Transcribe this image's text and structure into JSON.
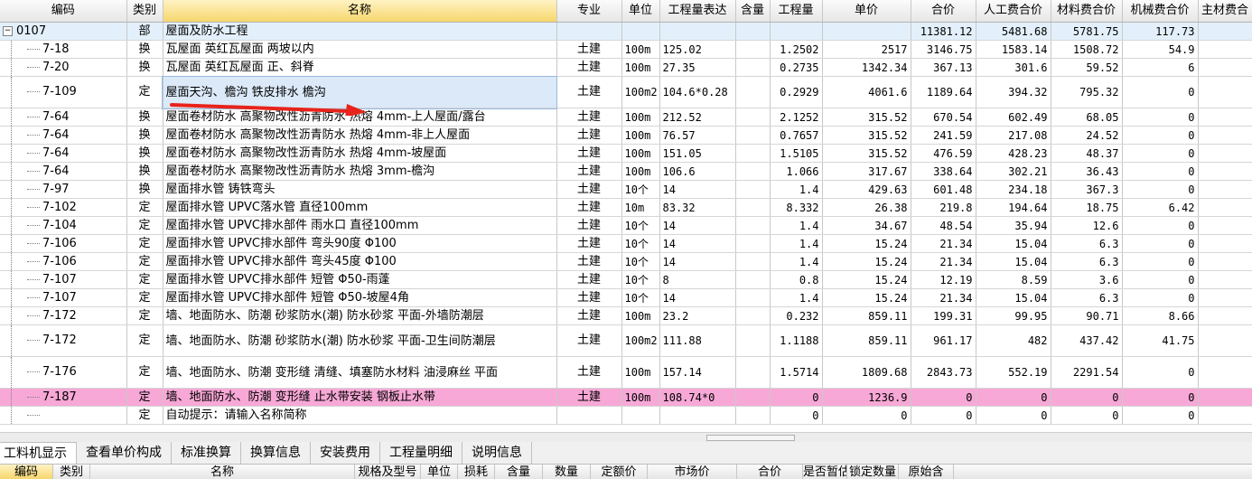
{
  "columns": [
    "编码",
    "类别",
    "名称",
    "专业",
    "单位",
    "工程量表达",
    "含量",
    "工程量",
    "单价",
    "合价",
    "人工费合价",
    "材料费合价",
    "机械费合价",
    "主材费合"
  ],
  "section": {
    "toggle": "−",
    "code": "0107",
    "category": "部",
    "name": "屋面及防水工程",
    "total": "11381.12",
    "labor": "5481.68",
    "material": "5781.75",
    "machine": "117.73"
  },
  "rows": [
    {
      "code": "7-18",
      "category": "换",
      "name": "瓦屋面 英红瓦屋面 两坡以内",
      "major": "土建",
      "unit": "100m",
      "expr": "125.02",
      "qty": "1.2502",
      "price": "2517",
      "total": "3146.75",
      "labor": "1583.14",
      "material": "1508.72",
      "machine": "54.9"
    },
    {
      "code": "7-20",
      "category": "换",
      "name": "瓦屋面 英红瓦屋面 正、斜脊",
      "major": "土建",
      "unit": "100m",
      "expr": "27.35",
      "qty": "0.2735",
      "price": "1342.34",
      "total": "367.13",
      "labor": "301.6",
      "material": "59.52",
      "machine": "6"
    },
    {
      "code": "7-109",
      "category": "定",
      "name": "屋面天沟、檐沟 铁皮排水 檐沟",
      "major": "土建",
      "unit": "100m2",
      "expr": "104.6*0.28",
      "qty": "0.2929",
      "price": "4061.6",
      "total": "1189.64",
      "labor": "394.32",
      "material": "795.32",
      "machine": "0"
    },
    {
      "code": "7-64",
      "category": "换",
      "name": "屋面卷材防水 高聚物改性沥青防水 热熔 4mm-上人屋面/露台",
      "major": "土建",
      "unit": "100m",
      "expr": "212.52",
      "qty": "2.1252",
      "price": "315.52",
      "total": "670.54",
      "labor": "602.49",
      "material": "68.05",
      "machine": "0"
    },
    {
      "code": "7-64",
      "category": "换",
      "name": "屋面卷材防水 高聚物改性沥青防水 热熔 4mm-非上人屋面",
      "major": "土建",
      "unit": "100m",
      "expr": "76.57",
      "qty": "0.7657",
      "price": "315.52",
      "total": "241.59",
      "labor": "217.08",
      "material": "24.52",
      "machine": "0"
    },
    {
      "code": "7-64",
      "category": "换",
      "name": "屋面卷材防水 高聚物改性沥青防水 热熔 4mm-坡屋面",
      "major": "土建",
      "unit": "100m",
      "expr": "151.05",
      "qty": "1.5105",
      "price": "315.52",
      "total": "476.59",
      "labor": "428.23",
      "material": "48.37",
      "machine": "0"
    },
    {
      "code": "7-64",
      "category": "换",
      "name": "屋面卷材防水 高聚物改性沥青防水 热熔 3mm-檐沟",
      "major": "土建",
      "unit": "100m",
      "expr": "106.6",
      "qty": "1.066",
      "price": "317.67",
      "total": "338.64",
      "labor": "302.21",
      "material": "36.43",
      "machine": "0"
    },
    {
      "code": "7-97",
      "category": "换",
      "name": "屋面排水管 铸铁弯头",
      "major": "土建",
      "unit": "10个",
      "expr": "14",
      "qty": "1.4",
      "price": "429.63",
      "total": "601.48",
      "labor": "234.18",
      "material": "367.3",
      "machine": "0"
    },
    {
      "code": "7-102",
      "category": "定",
      "name": "屋面排水管 UPVC落水管 直径100mm",
      "major": "土建",
      "unit": "10m",
      "expr": "83.32",
      "qty": "8.332",
      "price": "26.38",
      "total": "219.8",
      "labor": "194.64",
      "material": "18.75",
      "machine": "6.42"
    },
    {
      "code": "7-104",
      "category": "定",
      "name": "屋面排水管 UPVC排水部件 雨水口 直径100mm",
      "major": "土建",
      "unit": "10个",
      "expr": "14",
      "qty": "1.4",
      "price": "34.67",
      "total": "48.54",
      "labor": "35.94",
      "material": "12.6",
      "machine": "0"
    },
    {
      "code": "7-106",
      "category": "定",
      "name": "屋面排水管 UPVC排水部件 弯头90度 Φ100",
      "major": "土建",
      "unit": "10个",
      "expr": "14",
      "qty": "1.4",
      "price": "15.24",
      "total": "21.34",
      "labor": "15.04",
      "material": "6.3",
      "machine": "0"
    },
    {
      "code": "7-106",
      "category": "定",
      "name": "屋面排水管 UPVC排水部件 弯头45度 Φ100",
      "major": "土建",
      "unit": "10个",
      "expr": "14",
      "qty": "1.4",
      "price": "15.24",
      "total": "21.34",
      "labor": "15.04",
      "material": "6.3",
      "machine": "0"
    },
    {
      "code": "7-107",
      "category": "定",
      "name": "屋面排水管 UPVC排水部件 短管 Φ50-雨蓬",
      "major": "土建",
      "unit": "10个",
      "expr": "8",
      "qty": "0.8",
      "price": "15.24",
      "total": "12.19",
      "labor": "8.59",
      "material": "3.6",
      "machine": "0"
    },
    {
      "code": "7-107",
      "category": "定",
      "name": "屋面排水管 UPVC排水部件 短管 Φ50-坡屋4角",
      "major": "土建",
      "unit": "10个",
      "expr": "14",
      "qty": "1.4",
      "price": "15.24",
      "total": "21.34",
      "labor": "15.04",
      "material": "6.3",
      "machine": "0"
    },
    {
      "code": "7-172",
      "category": "定",
      "name": "墙、地面防水、防潮 砂浆防水(潮) 防水砂浆 平面-外墙防潮层",
      "major": "土建",
      "unit": "100m",
      "expr": "23.2",
      "qty": "0.232",
      "price": "859.11",
      "total": "199.31",
      "labor": "99.95",
      "material": "90.71",
      "machine": "8.66"
    },
    {
      "code": "7-172",
      "category": "定",
      "name": "墙、地面防水、防潮 砂浆防水(潮) 防水砂浆 平面-卫生间防潮层",
      "major": "土建",
      "unit": "100m2",
      "expr": "111.88",
      "qty": "1.1188",
      "price": "859.11",
      "total": "961.17",
      "labor": "482",
      "material": "437.42",
      "machine": "41.75"
    },
    {
      "code": "7-176",
      "category": "定",
      "name": "墙、地面防水、防潮 变形缝 清缝、填塞防水材料 油浸麻丝 平面",
      "major": "土建",
      "unit": "100m",
      "expr": "157.14",
      "qty": "1.5714",
      "price": "1809.68",
      "total": "2843.73",
      "labor": "552.19",
      "material": "2291.54",
      "machine": "0"
    },
    {
      "code": "7-187",
      "category": "定",
      "name": "墙、地面防水、防潮 变形缝 止水带安装 钢板止水带",
      "major": "土建",
      "unit": "100m",
      "expr": "108.74*0",
      "qty": "0",
      "price": "1236.9",
      "total": "0",
      "labor": "0",
      "material": "0",
      "machine": "0"
    },
    {
      "code": "",
      "category": "定",
      "name": "自动提示：请输入名称简称",
      "major": "",
      "unit": "",
      "expr": "",
      "qty": "0",
      "price": "0",
      "total": "0",
      "labor": "0",
      "material": "0",
      "machine": "0"
    }
  ],
  "tabs": [
    "工料机显示",
    "查看单价构成",
    "标准换算",
    "换算信息",
    "安装费用",
    "工程量明细",
    "说明信息"
  ],
  "sub_columns": [
    "编码",
    "类别",
    "名称",
    "规格及型号",
    "单位",
    "损耗",
    "含量",
    "数量",
    "定额价",
    "市场价",
    "合价",
    "是否暂估",
    "锁定数量",
    "原始含"
  ],
  "colors": {
    "accent_header": "#f6d66c",
    "section_row": "#e3f0fb",
    "highlight_row": "#f7a8d6",
    "arrow": "#e8231b"
  }
}
